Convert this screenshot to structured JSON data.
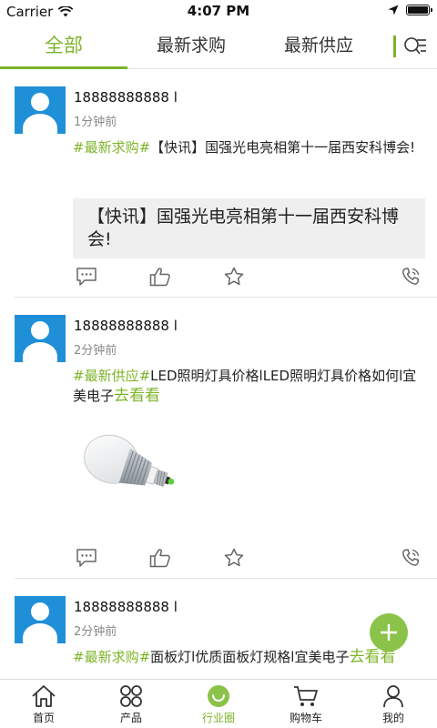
{
  "status_bar": {
    "carrier": "Carrier",
    "time": "4:07 PM"
  },
  "tabs": [
    {
      "label": "全部",
      "active": true
    },
    {
      "label": "最新求购",
      "active": false
    },
    {
      "label": "最新供应",
      "active": false
    }
  ],
  "posts": [
    {
      "user": "18888888888 l",
      "time": "1分钟前",
      "tag": "#最新求购#",
      "text": "【快讯】国强光电亮相第十一届西安科博会!",
      "more": "",
      "quote": "【快讯】国强光电亮相第十一届西安科博会!"
    },
    {
      "user": "18888888888 l",
      "time": "2分钟前",
      "tag": "#最新供应#",
      "text": "LED照明灯具价格lLED照明灯具价格如何l宜美电子",
      "more": "去看看",
      "image": "led-bulb"
    },
    {
      "user": "18888888888 l",
      "time": "2分钟前",
      "tag": "#最新求购#",
      "text": "面板灯l优质面板灯规格l宜美电子",
      "more": "去看看"
    }
  ],
  "bottom_nav": [
    {
      "label": "首页",
      "icon": "home-icon",
      "active": false
    },
    {
      "label": "产品",
      "icon": "grid-icon",
      "active": false
    },
    {
      "label": "行业圈",
      "icon": "circle-icon",
      "active": true
    },
    {
      "label": "购物车",
      "icon": "cart-icon",
      "active": false
    },
    {
      "label": "我的",
      "icon": "user-icon",
      "active": false
    }
  ],
  "colors": {
    "accent": "#7db429",
    "avatar": "#1f8fd8",
    "fab": "#8bc34a",
    "quote_bg": "#efefef"
  }
}
